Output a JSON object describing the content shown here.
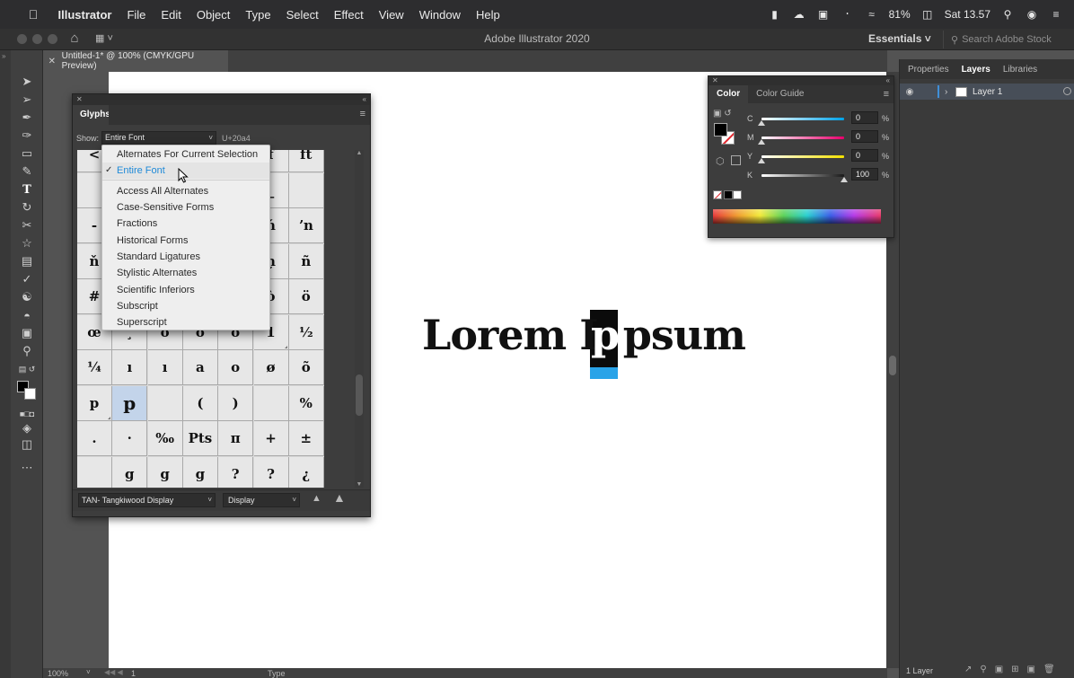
{
  "menubar": {
    "app_name": "Illustrator",
    "items": [
      "File",
      "Edit",
      "Object",
      "Type",
      "Select",
      "Effect",
      "View",
      "Window",
      "Help"
    ],
    "battery": "81%",
    "clock": "Sat 13.57"
  },
  "titlebar": {
    "title": "Adobe Illustrator 2020",
    "workspace": "Essentials",
    "search_placeholder": "Search Adobe Stock"
  },
  "document": {
    "tab_label": "Untitled-1* @ 100% (CMYK/GPU Preview)",
    "artwork_text_left": "Lorem I",
    "artwork_text_right": "psum",
    "artwork_glyph": "p"
  },
  "right_panel": {
    "tabs": [
      "Properties",
      "Layers",
      "Libraries"
    ],
    "active_tab": "Layers",
    "layer_name": "Layer 1",
    "footer": "1 Layer"
  },
  "color_panel": {
    "tabs": [
      "Color",
      "Color Guide"
    ],
    "active_tab": "Color",
    "sliders": [
      {
        "label": "C",
        "value": "0",
        "track_color": "#00a2e8",
        "level": 0
      },
      {
        "label": "M",
        "value": "0",
        "track_color": "#e8006c",
        "level": 0
      },
      {
        "label": "Y",
        "value": "0",
        "track_color": "#f2e000",
        "level": 0
      },
      {
        "label": "K",
        "value": "100",
        "track_color": "#1a1a1a",
        "level": 1
      }
    ],
    "pct": "%"
  },
  "glyphs_panel": {
    "title": "Glyphs",
    "show_label": "Show:",
    "show_value": "Entire Font",
    "unicode": "U+20a4",
    "font_name": "TAN- Tangkiwood Display",
    "font_style": "Display",
    "cells": [
      [
        "<",
        "",
        "",
        "",
        "",
        "f",
        "ft"
      ],
      [
        "",
        "",
        "",
        "",
        "",
        "_",
        ""
      ],
      [
        "-",
        "",
        "",
        "",
        "",
        "ń",
        "ʼn"
      ],
      [
        "ň",
        "",
        "",
        "",
        "",
        "ņ",
        "ñ"
      ],
      [
        "#",
        "",
        "",
        "",
        "",
        "ò",
        "ö"
      ],
      [
        "œ",
        "¸",
        "ò",
        "ö",
        "ō",
        "1",
        "½"
      ],
      [
        "¼",
        "ı",
        "ı",
        "a",
        "o",
        "ø",
        "õ"
      ],
      [
        "p",
        "p",
        "",
        "(",
        ")",
        "",
        "%"
      ],
      [
        ".",
        "·",
        "‰",
        "Pts",
        "π",
        "+",
        "±"
      ],
      [
        "",
        "g",
        "g",
        "g",
        "?",
        "?",
        "¿"
      ]
    ]
  },
  "dropdown": {
    "items": [
      "Alternates For Current Selection",
      "Entire Font",
      "Access All Alternates",
      "Case-Sensitive Forms",
      "Fractions",
      "Historical Forms",
      "Standard Ligatures",
      "Stylistic Alternates",
      "Scientific Inferiors",
      "Subscript",
      "Superscript"
    ],
    "checked": "Entire Font"
  },
  "statusbar": {
    "zoom": "100%",
    "page": "1",
    "tool": "Type"
  },
  "colors": {
    "accent_blue": "#29a3e8",
    "menu_check_blue": "#1f8ad8"
  }
}
